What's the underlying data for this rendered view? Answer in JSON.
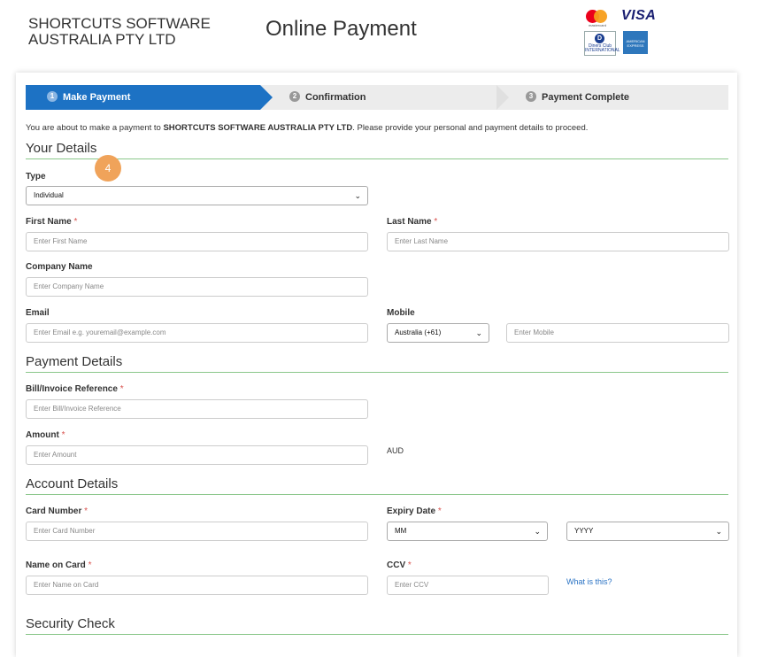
{
  "header": {
    "company_line1": "SHORTCUTS SOFTWARE",
    "company_line2": "AUSTRALIA PTY LTD",
    "title": "Online Payment",
    "cards": {
      "mastercard_text": "mastercard",
      "visa": "VISA",
      "diners_text": "Diners Club INTERNATIONAL",
      "amex_text": "AMERICAN EXPRESS"
    }
  },
  "steps": [
    {
      "num": "1",
      "label": "Make Payment"
    },
    {
      "num": "2",
      "label": "Confirmation"
    },
    {
      "num": "3",
      "label": "Payment Complete"
    }
  ],
  "intro": {
    "prefix": "You are about to make a payment to ",
    "company": "SHORTCUTS SOFTWARE AUSTRALIA PTY LTD",
    "suffix": ". Please provide your personal and payment details to proceed."
  },
  "sections": {
    "your_details": "Your Details",
    "payment_details": "Payment Details",
    "account_details": "Account Details",
    "security_check": "Security Check"
  },
  "fields": {
    "type": {
      "label": "Type",
      "value": "Individual"
    },
    "first_name": {
      "label": "First Name",
      "placeholder": "Enter First Name"
    },
    "last_name": {
      "label": "Last Name",
      "placeholder": "Enter Last Name"
    },
    "company_name": {
      "label": "Company Name",
      "placeholder": "Enter Company Name"
    },
    "email": {
      "label": "Email",
      "placeholder": "Enter Email e.g. youremail@example.com"
    },
    "mobile": {
      "label": "Mobile",
      "country": "Australia (+61)",
      "placeholder": "Enter Mobile"
    },
    "bill_ref": {
      "label": "Bill/Invoice Reference",
      "placeholder": "Enter Bill/Invoice Reference"
    },
    "amount": {
      "label": "Amount",
      "placeholder": "Enter Amount",
      "currency": "AUD"
    },
    "card_number": {
      "label": "Card Number",
      "placeholder": "Enter Card Number"
    },
    "expiry": {
      "label": "Expiry Date",
      "month": "MM",
      "year": "YYYY"
    },
    "name_on_card": {
      "label": "Name on Card",
      "placeholder": "Enter Name on Card"
    },
    "ccv": {
      "label": "CCV",
      "placeholder": "Enter CCV",
      "help_link": "What is this?"
    }
  },
  "required_mark": "*",
  "annotation_badge": "4"
}
